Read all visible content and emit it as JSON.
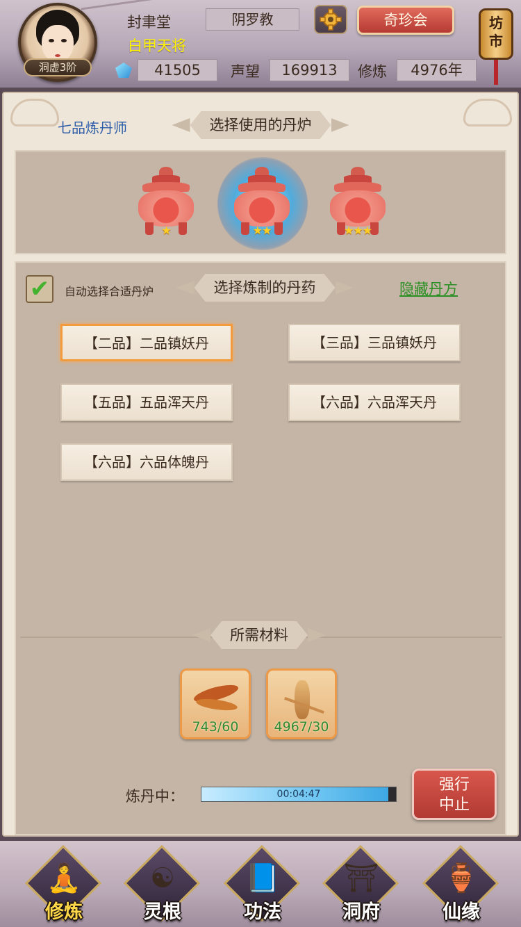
{
  "header": {
    "avatar_badge": "洞虚3阶",
    "player_name": "封聿堂",
    "player_title": "白甲天将",
    "sect": "阴罗教",
    "treasure_button": "奇珍会",
    "market_button": "坊市",
    "spirit_stones": "41505",
    "reputation_label": "声望",
    "reputation": "169913",
    "cultivation_label": "修炼",
    "cultivation": "4976年"
  },
  "furnace_section": {
    "alchemist_rank": "七品炼丹师",
    "title": "选择使用的丹炉",
    "furnaces": [
      {
        "stars": "★",
        "selected": false
      },
      {
        "stars": "★★",
        "selected": true
      },
      {
        "stars": "★★★",
        "selected": false
      }
    ]
  },
  "recipe_section": {
    "auto_select_label": "自动选择合适丹炉",
    "auto_select_checked": true,
    "title": "选择炼制的丹药",
    "hidden_recipe_link": "隐藏丹方",
    "recipes": [
      {
        "label": "【二品】二品镇妖丹",
        "selected": true
      },
      {
        "label": "【三品】三品镇妖丹",
        "selected": false
      },
      {
        "label": "【五品】五品浑天丹",
        "selected": false
      },
      {
        "label": "【六品】六品浑天丹",
        "selected": false
      },
      {
        "label": "【六品】六品体魄丹",
        "selected": false
      }
    ]
  },
  "materials_section": {
    "title": "所需材料",
    "materials": [
      {
        "icon": "herb-root-icon",
        "count": "743/60"
      },
      {
        "icon": "ginseng-icon",
        "count": "4967/30"
      }
    ]
  },
  "refining": {
    "label": "炼丹中：",
    "time_remaining": "00:04:47",
    "progress": 0.96,
    "force_stop_line1": "强行",
    "force_stop_line2": "中止"
  },
  "bottom_nav": [
    {
      "label": "修炼",
      "icon": "hooded-cultivator-icon",
      "active": true
    },
    {
      "label": "灵根",
      "icon": "yin-yang-sword-icon",
      "active": false
    },
    {
      "label": "功法",
      "icon": "scripture-book-icon",
      "active": false
    },
    {
      "label": "洞府",
      "icon": "pavilion-icon",
      "active": false
    },
    {
      "label": "仙缘",
      "icon": "gourd-icon",
      "active": false
    }
  ],
  "colors": {
    "accent_red": "#c9463f",
    "link_green": "#2a8f23",
    "alchemist_blue": "#2e5ea8",
    "title_yellow": "#fff200",
    "selected_orange": "#f29a3c"
  }
}
